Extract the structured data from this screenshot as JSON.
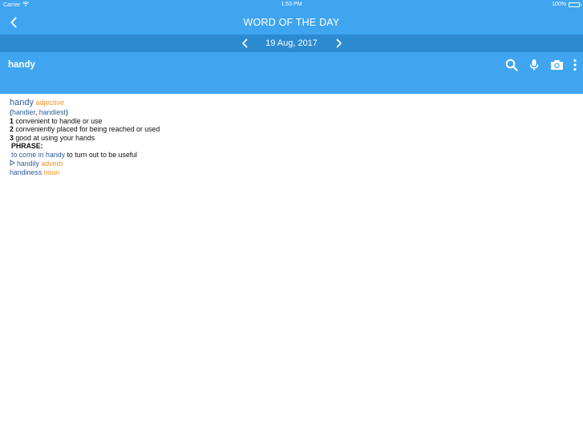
{
  "status_bar": {
    "carrier": "Carrier",
    "time": "1:53 PM",
    "battery": "100%"
  },
  "nav": {
    "title": "WORD OF THE DAY"
  },
  "date_bar": {
    "date": "19 Aug, 2017"
  },
  "search": {
    "term": "handy"
  },
  "entry": {
    "headword": "handy",
    "pos": "adjective",
    "forms": {
      "open": "(",
      "form1": "handier",
      "sep": ",",
      "form2": "handiest",
      "close": ")"
    },
    "senses": [
      {
        "num": "1",
        "text": "convenient to handle or use"
      },
      {
        "num": "2",
        "text": "conveniently placed for being reached or used"
      },
      {
        "num": "3",
        "text": "good at using your hands"
      }
    ],
    "phrase_label": "PHRASE:",
    "phrase": {
      "prefix": "to come in",
      "word": "handy",
      "meaning": "to turn out to be useful"
    },
    "derived": [
      {
        "word": "handily",
        "pos": "adverb"
      },
      {
        "word": "handiness",
        "pos": "noun"
      }
    ]
  },
  "colors": {
    "header": "#3fa5f0",
    "date_bar": "#2c8ad1",
    "link_blue": "#2f5c9a",
    "pos_orange": "#f0952c"
  },
  "icons": {
    "back": "chevron-left-icon",
    "prev": "chevron-left-icon",
    "next": "chevron-right-icon",
    "search": "search-icon",
    "mic": "microphone-icon",
    "camera": "camera-icon",
    "more": "more-vertical-icon",
    "wifi": "wifi-icon",
    "battery": "battery-icon"
  }
}
